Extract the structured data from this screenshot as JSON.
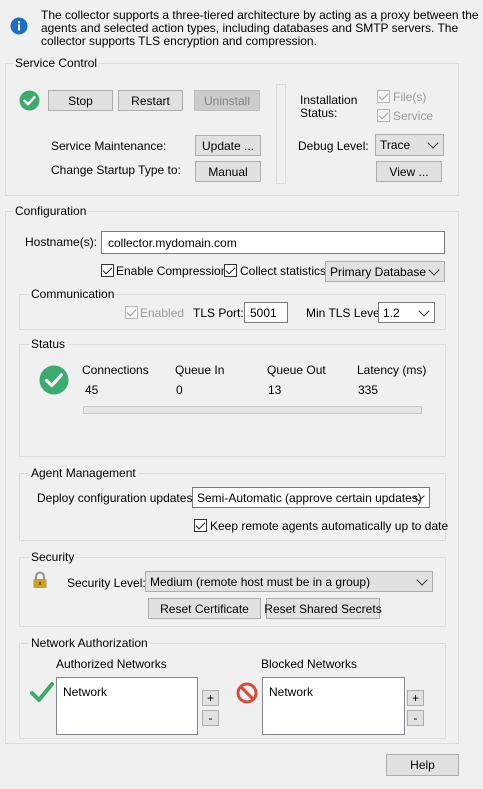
{
  "info": {
    "text_line1": "The collector supports a three-tiered architecture by acting as a proxy between the",
    "text_line2": "agents and selected action types, including databases and SMTP servers. The",
    "text_line3": "collector supports TLS encryption and compression."
  },
  "service_control": {
    "title": "Service Control",
    "stop_label": "Stop",
    "restart_label": "Restart",
    "uninstall_label": "Uninstall",
    "maintenance_label": "Service Maintenance:",
    "update_label": "Update ...",
    "startup_label": "Change Startup Type to:",
    "manual_label": "Manual",
    "installation_status_label_line1": "Installation",
    "installation_status_label_line2": "Status:",
    "files_label": "File(s)",
    "service_label": "Service",
    "debug_label": "Debug Level:",
    "debug_value": "Trace",
    "view_label": "View ..."
  },
  "configuration": {
    "title": "Configuration",
    "hostname_label": "Hostname(s):",
    "hostname_value": "collector.mydomain.com",
    "enable_compression_label": "Enable Compression",
    "collect_statistics_label": "Collect statistics:",
    "statistics_target": "Primary Database"
  },
  "communication": {
    "title": "Communication",
    "enabled_label": "Enabled",
    "tls_port_label": "TLS Port:",
    "tls_port_value": "5001",
    "min_tls_label": "Min TLS Level:",
    "min_tls_value": "1.2"
  },
  "status": {
    "title": "Status",
    "headers": [
      "Connections",
      "Queue In",
      "Queue Out",
      "Latency (ms)"
    ],
    "values": [
      "45",
      "0",
      "13",
      "335"
    ],
    "progress": 0
  },
  "agent_management": {
    "title": "Agent Management",
    "deploy_label": "Deploy configuration updates:",
    "deploy_value": "Semi-Automatic (approve certain updates)",
    "keep_updated_label": "Keep remote agents automatically up to date"
  },
  "security": {
    "title": "Security",
    "level_label": "Security Level:",
    "level_value": "Medium (remote host must be in a group)",
    "reset_certificate_label": "Reset Certificate",
    "reset_secrets_label": "Reset Shared Secrets"
  },
  "network_authorization": {
    "title": "Network Authorization",
    "authorized_title": "Authorized Networks",
    "authorized_header": "Network",
    "blocked_title": "Blocked Networks",
    "blocked_header": "Network",
    "plus": "+",
    "minus": "-"
  },
  "footer": {
    "help_label": "Help"
  },
  "colors": {
    "success_green": "#3cab6e",
    "block_red": "#d64b3b",
    "info_blue": "#1c6fc4",
    "lock_gold": "#c9a227"
  }
}
